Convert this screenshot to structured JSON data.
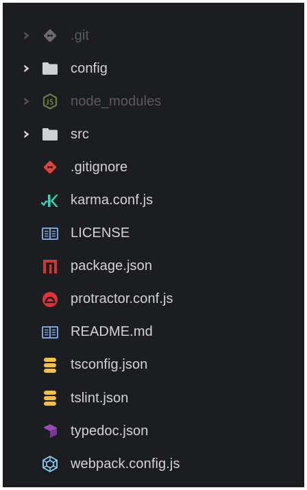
{
  "explorer": {
    "items": [
      {
        "label": ".git",
        "kind": "folder",
        "icon": "git-icon",
        "dimmed": true,
        "collapsed": true
      },
      {
        "label": "config",
        "kind": "folder",
        "icon": "folder-icon",
        "dimmed": false,
        "collapsed": true
      },
      {
        "label": "node_modules",
        "kind": "folder",
        "icon": "nodejs-icon",
        "dimmed": true,
        "collapsed": true
      },
      {
        "label": "src",
        "kind": "folder",
        "icon": "folder-icon",
        "dimmed": false,
        "collapsed": true
      },
      {
        "label": ".gitignore",
        "kind": "file",
        "icon": "git-icon",
        "dimmed": false
      },
      {
        "label": "karma.conf.js",
        "kind": "file",
        "icon": "karma-icon",
        "dimmed": false
      },
      {
        "label": "LICENSE",
        "kind": "file",
        "icon": "book-icon",
        "dimmed": false
      },
      {
        "label": "package.json",
        "kind": "file",
        "icon": "npm-icon",
        "dimmed": false
      },
      {
        "label": "protractor.conf.js",
        "kind": "file",
        "icon": "protractor-icon",
        "dimmed": false
      },
      {
        "label": "README.md",
        "kind": "file",
        "icon": "book-icon",
        "dimmed": false
      },
      {
        "label": "tsconfig.json",
        "kind": "file",
        "icon": "database-icon",
        "dimmed": false
      },
      {
        "label": "tslint.json",
        "kind": "file",
        "icon": "database-icon",
        "dimmed": false
      },
      {
        "label": "typedoc.json",
        "kind": "file",
        "icon": "typedoc-icon",
        "dimmed": false
      },
      {
        "label": "webpack.config.js",
        "kind": "file",
        "icon": "webpack-icon",
        "dimmed": false
      }
    ]
  },
  "colors": {
    "background": "#1c1d21",
    "text": "#d3d4d6",
    "text_dim": "#5a5b60",
    "folder": "#cfd0d3",
    "git": "#e0453a",
    "git_dim": "#6a6b70",
    "node_dim": "#6e7a3e",
    "karma": "#3ecfb2",
    "book": "#7aa6d9",
    "npm": "#cb3837",
    "protractor": "#e23237",
    "database": "#f5c04a",
    "typedoc": "#9a4eb5",
    "webpack": "#8ed6fb"
  }
}
